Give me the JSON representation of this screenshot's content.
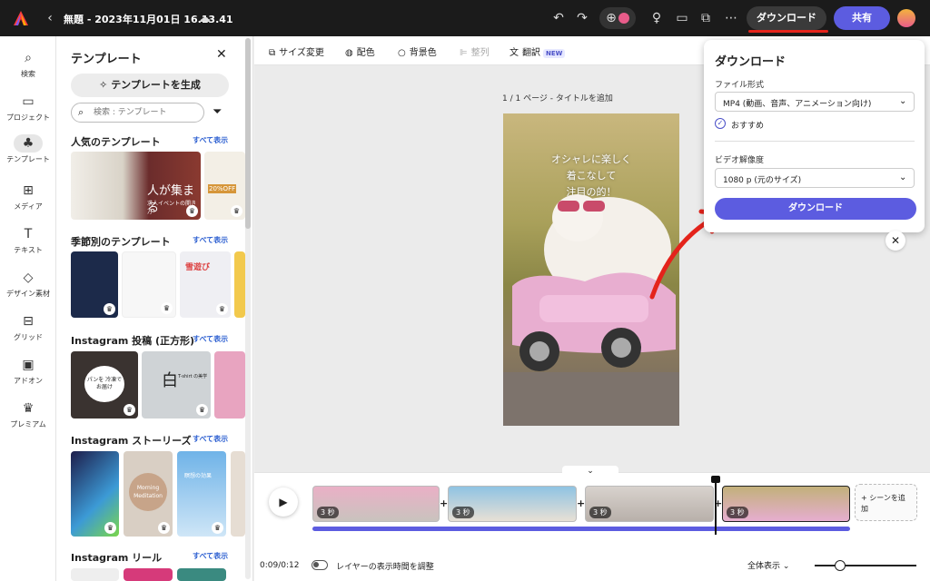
{
  "topbar": {
    "doc_title": "無題 - 2023年11月01日 16.13.41",
    "download_label": "ダウンロード",
    "share_label": "共有"
  },
  "rail": [
    {
      "label": "検索",
      "icon": "search-icon"
    },
    {
      "label": "プロジェクト",
      "icon": "folder-icon"
    },
    {
      "label": "テンプレート",
      "icon": "template-icon"
    },
    {
      "label": "メディア",
      "icon": "media-icon"
    },
    {
      "label": "テキスト",
      "icon": "text-icon"
    },
    {
      "label": "デザイン素材",
      "icon": "shapes-icon"
    },
    {
      "label": "グリッド",
      "icon": "grid-icon"
    },
    {
      "label": "アドオン",
      "icon": "addon-icon"
    },
    {
      "label": "プレミアム",
      "icon": "crown-icon"
    }
  ],
  "panel": {
    "title": "テンプレート",
    "generate_label": "テンプレートを生成",
    "search_placeholder": "検索 : テンプレート",
    "sections": [
      {
        "title": "人気のテンプレート",
        "see_all": "すべて表示"
      },
      {
        "title": "季節別のテンプレート",
        "see_all": "すべて表示"
      },
      {
        "title": "Instagram 投稿 (正方形)",
        "see_all": "すべて表示"
      },
      {
        "title": "Instagram ストーリーズ",
        "see_all": "すべて表示"
      },
      {
        "title": "Instagram リール",
        "see_all": "すべて表示"
      }
    ],
    "thumb_texts": {
      "popular_1": "人が集まる",
      "popular_1_sub": "求人イベントの開き方",
      "popular_2": "20%OFF",
      "season_3": "雪遊び",
      "insta_1": "パンを 冷凍でお届け",
      "insta_2": "白",
      "insta_2_sub": "T-shirt の美学",
      "story_2": "Morning Meditation",
      "story_3": "瞑想の効果"
    }
  },
  "toolbar": {
    "resize": "サイズ変更",
    "color": "配色",
    "background": "背景色",
    "arrange": "整列",
    "translate": "翻訳",
    "new_badge": "NEW"
  },
  "canvas": {
    "page_label": "1 / 1 ページ - タイトルを追加",
    "art_lines": [
      "オシャレに楽しく",
      "着こなして",
      "注目の的！"
    ]
  },
  "download_popup": {
    "title": "ダウンロード",
    "format_label": "ファイル形式",
    "format_value": "MP4 (動画、音声、アニメーション向け)",
    "recommended": "おすすめ",
    "resolution_label": "ビデオ解像度",
    "resolution_value": "1080 p (元のサイズ)",
    "download_button": "ダウンロード"
  },
  "timeline": {
    "clips": [
      {
        "duration": "3 秒"
      },
      {
        "duration": "3 秒"
      },
      {
        "duration": "3 秒"
      },
      {
        "duration": "3 秒"
      }
    ],
    "add_scene": "+ シーンを追加",
    "time": "0:09/0:12",
    "layer_toggle_label": "レイヤーの表示時間を調整",
    "zoom_label": "全体表示",
    "zoom_level": 0.25,
    "playhead_fraction": 0.75
  },
  "colors": {
    "accent": "#5c5ce0",
    "underline": "#e4231b",
    "topbar": "#1b1b1b"
  }
}
